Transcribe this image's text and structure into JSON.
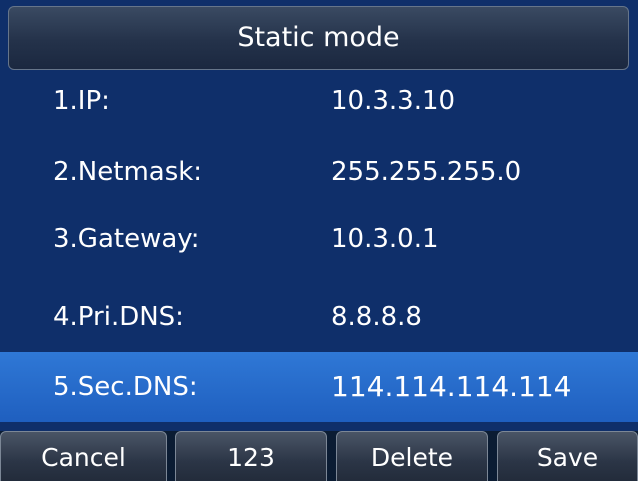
{
  "title": "Static mode",
  "fields": [
    {
      "label": "1.IP:",
      "value": "10.3.3.10"
    },
    {
      "label": "2.Netmask:",
      "value": "255.255.255.0"
    },
    {
      "label": "3.Gateway:",
      "value": "10.3.0.1"
    },
    {
      "label": "4.Pri.DNS:",
      "value": "8.8.8.8"
    },
    {
      "label": "5.Sec.DNS:",
      "value": "114.114.114.114"
    }
  ],
  "selected_field": "5.Sec.DNS:",
  "softkeys": {
    "cancel": "Cancel",
    "input_mode": "123",
    "delete": "Delete",
    "save": "Save"
  },
  "colors": {
    "background": "#0f2f6a",
    "selection": "#2f78d6"
  }
}
